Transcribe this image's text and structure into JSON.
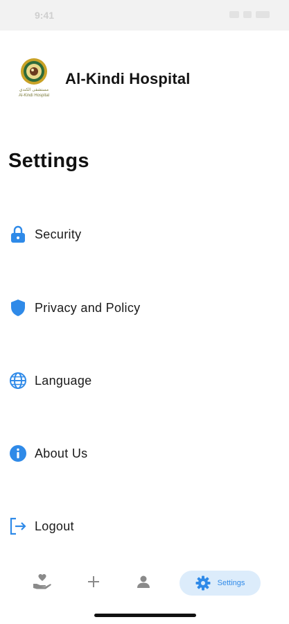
{
  "status_bar": {
    "time": "9:41"
  },
  "header": {
    "hospital_name": "Al-Kindi Hospital",
    "logo_text_ar": "مستشفى الكندي",
    "logo_text_en": "Al-Kindi Hospital"
  },
  "page": {
    "title": "Settings"
  },
  "menu": {
    "items": [
      {
        "label": "Security",
        "icon": "lock-icon"
      },
      {
        "label": "Privacy and Policy",
        "icon": "shield-icon"
      },
      {
        "label": "Language",
        "icon": "globe-icon"
      },
      {
        "label": "About Us",
        "icon": "info-icon"
      },
      {
        "label": "Logout",
        "icon": "logout-icon"
      }
    ]
  },
  "bottom_nav": {
    "items": [
      {
        "icon": "hand-heart-icon",
        "active": false
      },
      {
        "icon": "plus-icon",
        "active": false
      },
      {
        "icon": "person-icon",
        "active": false
      },
      {
        "icon": "gear-icon",
        "label": "Settings",
        "active": true
      }
    ]
  },
  "colors": {
    "accent": "#2f8ae8",
    "active_pill": "#dcecfb",
    "inactive_icon": "#8a8a8a",
    "logo_gold": "#c9a227",
    "logo_green": "#2e6b3a"
  }
}
